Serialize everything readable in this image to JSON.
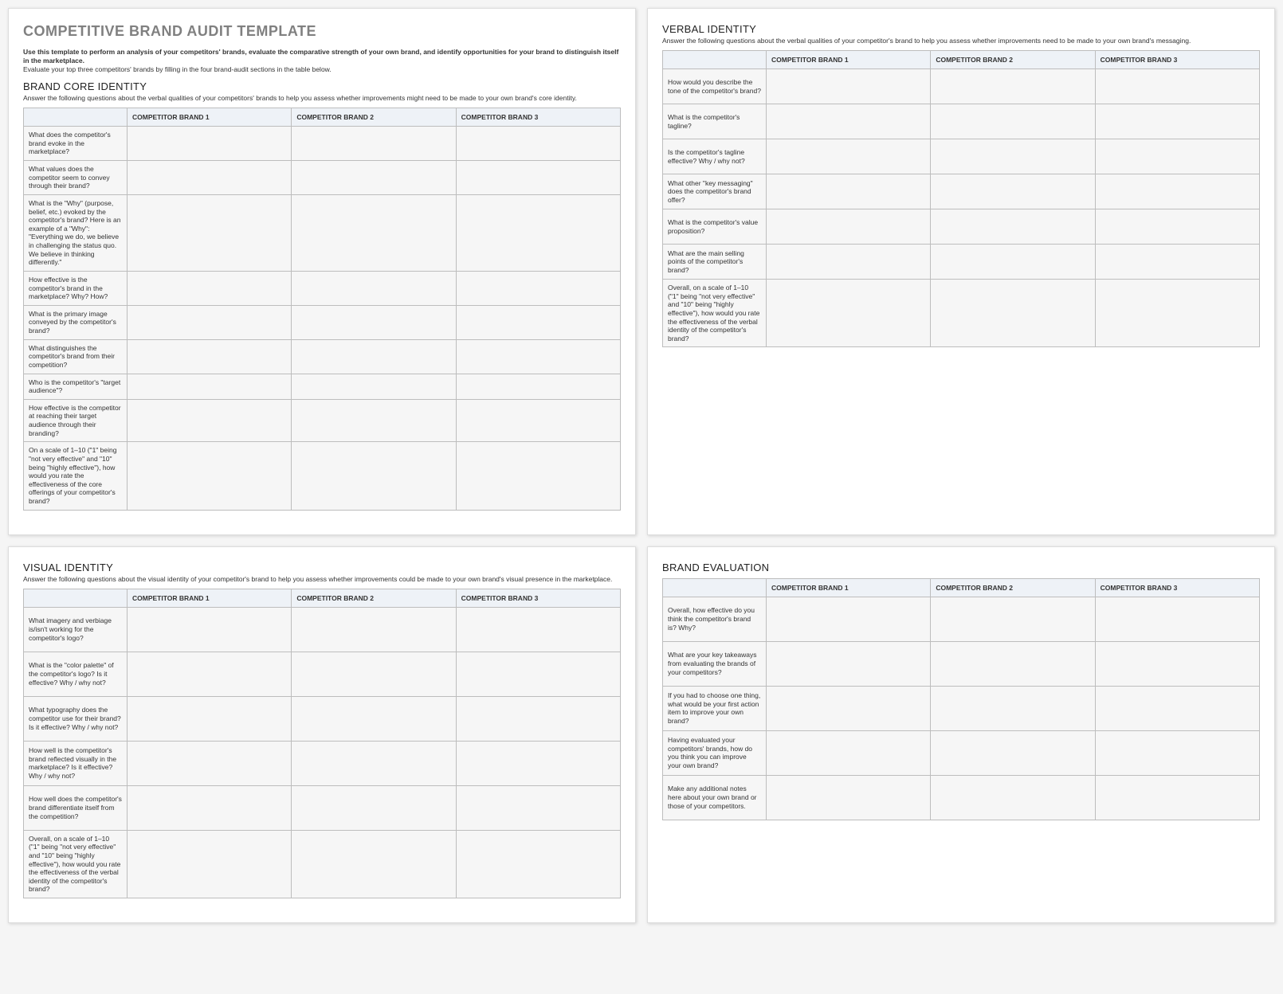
{
  "mainTitle": "COMPETITIVE BRAND AUDIT TEMPLATE",
  "introBold": "Use this template to perform an analysis of your competitors' brands, evaluate the comparative strength of your own brand, and identify opportunities for your brand to distinguish itself in the marketplace.",
  "introPlain": "Evaluate your top three competitors' brands by filling in the four brand-audit sections in the table below.",
  "columns": {
    "empty": "",
    "c1": "COMPETITOR BRAND 1",
    "c2": "COMPETITOR BRAND 2",
    "c3": "COMPETITOR BRAND 3"
  },
  "core": {
    "title": "BRAND CORE IDENTITY",
    "desc": "Answer the following questions about the verbal qualities of your competitors' brands to help you assess whether improvements might need to be made to your own brand's core identity.",
    "rows": [
      "What does the competitor's brand evoke in the marketplace?",
      "What values does the competitor seem to convey through their brand?",
      "What is the \"Why\" (purpose, belief, etc.) evoked by the competitor's brand? Here is an example of a \"Why\": \"Everything we do, we believe in challenging the status quo. We believe in thinking differently.\"",
      "How effective is the competitor's brand in the marketplace? Why? How?",
      "What is the primary image conveyed by the competitor's brand?",
      "What distinguishes the competitor's brand from their competition?",
      "Who is the competitor's \"target audience\"?",
      "How effective is the competitor at reaching their target audience through their branding?",
      "On a scale of 1–10 (\"1\" being \"not very effective\" and \"10\" being \"highly effective\"), how would you rate the effectiveness of the core offerings of your competitor's brand?"
    ]
  },
  "verbal": {
    "title": "VERBAL IDENTITY",
    "desc": "Answer the following questions about the verbal qualities of your competitor's brand to help you assess whether improvements need to be made to your own brand's messaging.",
    "rows": [
      "How would you describe the tone of the competitor's brand?",
      "What is the competitor's tagline?",
      "Is the competitor's tagline effective? Why / why not?",
      "What other \"key messaging\" does the competitor's brand offer?",
      "What is the competitor's value proposition?",
      "What are the main selling points of the competitor's brand?",
      "Overall, on a scale of 1–10 (\"1\" being \"not very effective\" and \"10\" being \"highly effective\"), how would you rate the effectiveness of the verbal identity of the competitor's brand?"
    ]
  },
  "visual": {
    "title": "VISUAL IDENTITY",
    "desc": "Answer the following questions about the visual identity of your competitor's brand to help you assess whether improvements could be made to your own brand's visual presence in the marketplace.",
    "rows": [
      "What imagery and verbiage is/isn't working for the competitor's logo?",
      "What is the \"color palette\" of the competitor's logo? Is it effective? Why / why not?",
      "What typography does the competitor use for their brand? Is it effective? Why / why not?",
      "How well is the competitor's brand reflected visually in the marketplace? Is it effective? Why / why not?",
      "How well does the competitor's  brand differentiate itself from the competition?",
      "Overall, on a scale of 1–10 (\"1\" being \"not very effective\" and \"10\" being \"highly effective\"), how would you rate the effectiveness of the verbal identity of the competitor's brand?"
    ]
  },
  "evaluation": {
    "title": "BRAND EVALUATION",
    "rows": [
      "Overall, how effective do you think the competitor's brand is? Why?",
      "What are your key takeaways from evaluating the brands of your competitors?",
      "If you had to choose one thing, what would be your first action item to improve your own brand?",
      "Having evaluated your competitors' brands, how do you think you can improve your own brand?",
      "Make any additional notes here about your own brand or those of your competitors."
    ]
  }
}
